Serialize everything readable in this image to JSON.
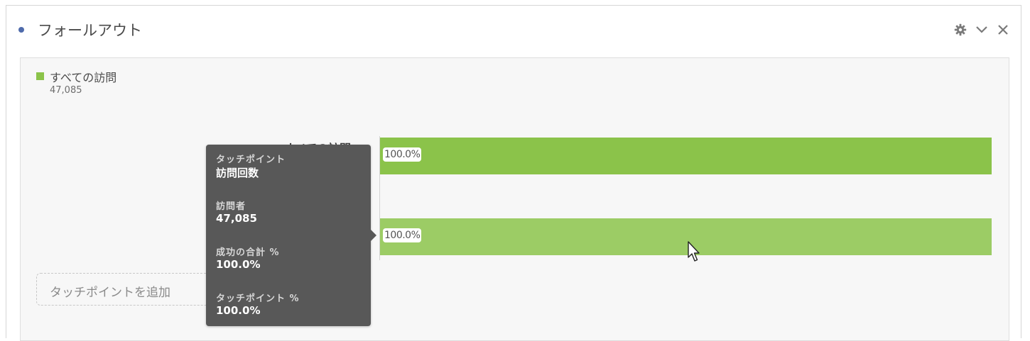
{
  "panel": {
    "title": "フォールアウト",
    "dot_color": "#4f6bab",
    "actions": [
      "gear-icon",
      "chevron-down-icon",
      "close-icon"
    ]
  },
  "legend": {
    "label": "すべての訪問",
    "value": "47,085",
    "color": "#8bc34a"
  },
  "touchpoints": [
    {
      "label": "すべての訪問",
      "percent_label": "100.0%",
      "percent": 100.0,
      "color": "#8bc34a"
    },
    {
      "label": "",
      "percent_label": "100.0%",
      "percent": 100.0,
      "color": "#9ccc65"
    }
  ],
  "add_touchpoint": {
    "placeholder": "タッチポイントを追加"
  },
  "tooltip": {
    "items": [
      {
        "label": "タッチポイント",
        "value": "訪問回数"
      },
      {
        "label": "訪問者",
        "value": "47,085"
      },
      {
        "label": "成功の合計 %",
        "value": "100.0%"
      },
      {
        "label": "タッチポイント %",
        "value": "100.0%"
      }
    ]
  }
}
